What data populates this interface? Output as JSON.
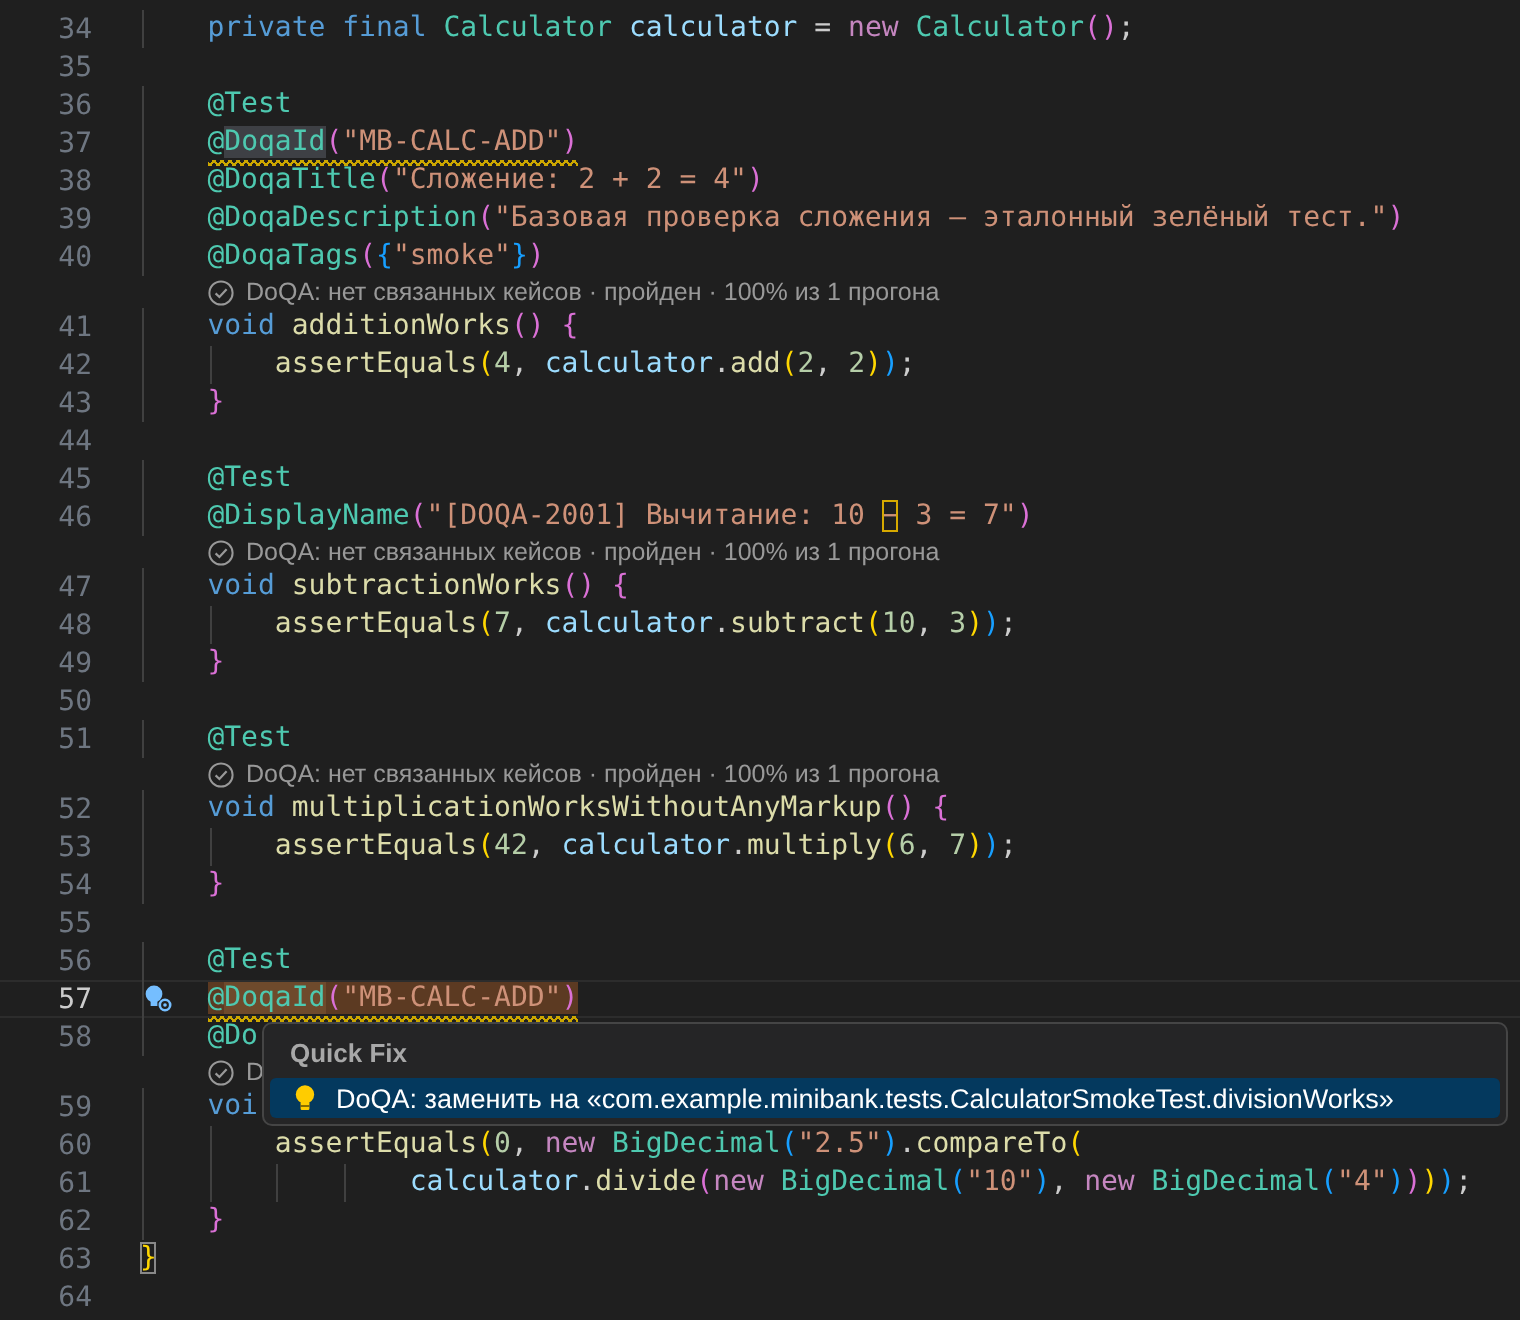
{
  "editor": {
    "lines": [
      {
        "kind": "code",
        "number": "34",
        "current": false,
        "warning": false,
        "tokens": [
          {
            "text": "    private final ",
            "kind": "kw"
          },
          {
            "text": "Calculator",
            "kind": "type"
          },
          {
            "text": " calculator",
            "kind": "var"
          },
          {
            "text": " = ",
            "kind": "plain"
          },
          {
            "text": "new",
            "kind": "ctrl"
          },
          {
            "text": " Calculator",
            "kind": "type"
          },
          {
            "text": "()",
            "kind": "b2"
          },
          {
            "text": ";",
            "kind": "plain"
          }
        ]
      },
      {
        "kind": "code",
        "number": "35",
        "current": false
      },
      {
        "kind": "code",
        "number": "36",
        "current": false,
        "warning": false,
        "tokens": [
          {
            "text": "    @Test",
            "kind": "ann"
          }
        ]
      },
      {
        "kind": "code",
        "number": "37",
        "current": false,
        "warning": true,
        "tokens": [
          {
            "text": "    @",
            "kind": "ann"
          },
          {
            "text": "DoqaId",
            "kind": "ann",
            "symbol_highlight": true
          },
          {
            "text": "(",
            "kind": "b2"
          },
          {
            "text": "\"MB-CALC-ADD\"",
            "kind": "str"
          },
          {
            "text": ")",
            "kind": "b2"
          }
        ]
      },
      {
        "kind": "code",
        "number": "38",
        "current": false,
        "warning": false,
        "tokens": [
          {
            "text": "    @DoqaTitle",
            "kind": "ann"
          },
          {
            "text": "(",
            "kind": "b2"
          },
          {
            "text": "\"Сложение: 2 + 2 = 4\"",
            "kind": "str"
          },
          {
            "text": ")",
            "kind": "b2"
          }
        ]
      },
      {
        "kind": "code",
        "number": "39",
        "current": false,
        "warning": false,
        "tokens": [
          {
            "text": "    @DoqaDescription",
            "kind": "ann"
          },
          {
            "text": "(",
            "kind": "b2"
          },
          {
            "text": "\"Базовая проверка сложения — эталонный зелёный тест.\"",
            "kind": "str"
          },
          {
            "text": ")",
            "kind": "b2"
          }
        ]
      },
      {
        "kind": "code",
        "number": "40",
        "current": false,
        "warning": false,
        "tokens": [
          {
            "text": "    @DoqaTags",
            "kind": "ann"
          },
          {
            "text": "(",
            "kind": "b2"
          },
          {
            "text": "{",
            "kind": "b3"
          },
          {
            "text": "\"smoke\"",
            "kind": "str"
          },
          {
            "text": "}",
            "kind": "b3"
          },
          {
            "text": ")",
            "kind": "b2"
          }
        ]
      },
      {
        "kind": "lens",
        "text": "DoQA: нет связанных кейсов · пройден · 100% из 1 прогона"
      },
      {
        "kind": "code",
        "number": "41",
        "current": false,
        "warning": false,
        "tokens": [
          {
            "text": "    void ",
            "kind": "kw"
          },
          {
            "text": "additionWorks",
            "kind": "fn"
          },
          {
            "text": "() {",
            "kind": "b2"
          }
        ]
      },
      {
        "kind": "code",
        "number": "42",
        "current": false,
        "warning": false,
        "tokens": [
          {
            "text": "        assertEquals",
            "kind": "fn"
          },
          {
            "text": "(",
            "kind": "b1"
          },
          {
            "text": "4",
            "kind": "num"
          },
          {
            "text": ", ",
            "kind": "plain"
          },
          {
            "text": "calculator",
            "kind": "var"
          },
          {
            "text": ".",
            "kind": "plain"
          },
          {
            "text": "add",
            "kind": "fn"
          },
          {
            "text": "(",
            "kind": "b1"
          },
          {
            "text": "2",
            "kind": "num"
          },
          {
            "text": ", ",
            "kind": "plain"
          },
          {
            "text": "2",
            "kind": "num"
          },
          {
            "text": ")",
            "kind": "b1"
          },
          {
            "text": ")",
            "kind": "b3"
          },
          {
            "text": ";",
            "kind": "plain"
          }
        ]
      },
      {
        "kind": "code",
        "number": "43",
        "current": false,
        "warning": false,
        "tokens": [
          {
            "text": "    }",
            "kind": "b2"
          }
        ]
      },
      {
        "kind": "code",
        "number": "44",
        "current": false
      },
      {
        "kind": "code",
        "number": "45",
        "current": false,
        "warning": false,
        "tokens": [
          {
            "text": "    @Test",
            "kind": "ann"
          }
        ]
      },
      {
        "kind": "code",
        "number": "46",
        "current": false,
        "warning": false,
        "tokens": [
          {
            "text": "    @DisplayName",
            "kind": "ann"
          },
          {
            "text": "(",
            "kind": "b2"
          },
          {
            "text": "\"[DOQA-2001] Вычитание: 10 ",
            "kind": "str"
          },
          {
            "text": "−",
            "kind": "str",
            "ambiguous": true
          },
          {
            "text": " 3 = 7\"",
            "kind": "str"
          },
          {
            "text": ")",
            "kind": "b2"
          }
        ]
      },
      {
        "kind": "lens",
        "text": "DoQA: нет связанных кейсов · пройден · 100% из 1 прогона"
      },
      {
        "kind": "code",
        "number": "47",
        "current": false,
        "warning": false,
        "tokens": [
          {
            "text": "    void ",
            "kind": "kw"
          },
          {
            "text": "subtractionWorks",
            "kind": "fn"
          },
          {
            "text": "() {",
            "kind": "b2"
          }
        ]
      },
      {
        "kind": "code",
        "number": "48",
        "current": false,
        "warning": false,
        "tokens": [
          {
            "text": "        assertEquals",
            "kind": "fn"
          },
          {
            "text": "(",
            "kind": "b1"
          },
          {
            "text": "7",
            "kind": "num"
          },
          {
            "text": ", ",
            "kind": "plain"
          },
          {
            "text": "calculator",
            "kind": "var"
          },
          {
            "text": ".",
            "kind": "plain"
          },
          {
            "text": "subtract",
            "kind": "fn"
          },
          {
            "text": "(",
            "kind": "b1"
          },
          {
            "text": "10",
            "kind": "num"
          },
          {
            "text": ", ",
            "kind": "plain"
          },
          {
            "text": "3",
            "kind": "num"
          },
          {
            "text": ")",
            "kind": "b1"
          },
          {
            "text": ")",
            "kind": "b3"
          },
          {
            "text": ";",
            "kind": "plain"
          }
        ]
      },
      {
        "kind": "code",
        "number": "49",
        "current": false,
        "warning": false,
        "tokens": [
          {
            "text": "    }",
            "kind": "b2"
          }
        ]
      },
      {
        "kind": "code",
        "number": "50",
        "current": false
      },
      {
        "kind": "code",
        "number": "51",
        "current": false,
        "warning": false,
        "tokens": [
          {
            "text": "    @Test",
            "kind": "ann"
          }
        ]
      },
      {
        "kind": "lens",
        "text": "DoQA: нет связанных кейсов · пройден · 100% из 1 прогона"
      },
      {
        "kind": "code",
        "number": "52",
        "current": false,
        "warning": false,
        "tokens": [
          {
            "text": "    void ",
            "kind": "kw"
          },
          {
            "text": "multiplicationWorksWithoutAnyMarkup",
            "kind": "fn"
          },
          {
            "text": "() {",
            "kind": "b2"
          }
        ]
      },
      {
        "kind": "code",
        "number": "53",
        "current": false,
        "warning": false,
        "tokens": [
          {
            "text": "        assertEquals",
            "kind": "fn"
          },
          {
            "text": "(",
            "kind": "b1"
          },
          {
            "text": "42",
            "kind": "num"
          },
          {
            "text": ", ",
            "kind": "plain"
          },
          {
            "text": "calculator",
            "kind": "var"
          },
          {
            "text": ".",
            "kind": "plain"
          },
          {
            "text": "multiply",
            "kind": "fn"
          },
          {
            "text": "(",
            "kind": "b1"
          },
          {
            "text": "6",
            "kind": "num"
          },
          {
            "text": ", ",
            "kind": "plain"
          },
          {
            "text": "7",
            "kind": "num"
          },
          {
            "text": ")",
            "kind": "b1"
          },
          {
            "text": ")",
            "kind": "b3"
          },
          {
            "text": ";",
            "kind": "plain"
          }
        ]
      },
      {
        "kind": "code",
        "number": "54",
        "current": false,
        "warning": false,
        "tokens": [
          {
            "text": "    }",
            "kind": "b2"
          }
        ]
      },
      {
        "kind": "code",
        "number": "55",
        "current": false
      },
      {
        "kind": "code",
        "number": "56",
        "current": false,
        "warning": false,
        "tokens": [
          {
            "text": "    @Test",
            "kind": "ann"
          }
        ]
      },
      {
        "kind": "code",
        "number": "57",
        "current": true,
        "warning": true,
        "tokens": [
          {
            "text": "    @",
            "kind": "ann",
            "quick_fix": true
          },
          {
            "text": "DoqaId",
            "kind": "ann",
            "quick_fix": true,
            "symbol_highlight": true
          },
          {
            "text": "(",
            "kind": "b2",
            "quick_fix": true
          },
          {
            "text": "\"MB-CALC-ADD\"",
            "kind": "str",
            "quick_fix": true
          },
          {
            "text": ")",
            "kind": "b2",
            "quick_fix": true
          }
        ]
      },
      {
        "kind": "code",
        "number": "58",
        "current": false,
        "warning": false,
        "tokens": [
          {
            "text": "    @Do",
            "kind": "ann"
          }
        ]
      },
      {
        "kind": "lens",
        "text": "D"
      },
      {
        "kind": "code",
        "number": "59",
        "current": false,
        "warning": false,
        "tokens": [
          {
            "text": "    voi",
            "kind": "kw"
          }
        ]
      },
      {
        "kind": "code",
        "number": "60",
        "current": false,
        "warning": false,
        "tokens": [
          {
            "text": "        assertEquals",
            "kind": "fn"
          },
          {
            "text": "(",
            "kind": "b1"
          },
          {
            "text": "0",
            "kind": "num"
          },
          {
            "text": ", ",
            "kind": "plain"
          },
          {
            "text": "new",
            "kind": "ctrl"
          },
          {
            "text": " BigDecimal",
            "kind": "type"
          },
          {
            "text": "(",
            "kind": "b3"
          },
          {
            "text": "\"2.5\"",
            "kind": "str"
          },
          {
            "text": ")",
            "kind": "b3"
          },
          {
            "text": ".",
            "kind": "plain"
          },
          {
            "text": "compareTo",
            "kind": "fn"
          },
          {
            "text": "(",
            "kind": "b1"
          }
        ]
      },
      {
        "kind": "code",
        "number": "61",
        "current": false,
        "warning": false,
        "tokens": [
          {
            "text": "                calculator",
            "kind": "var"
          },
          {
            "text": ".",
            "kind": "plain"
          },
          {
            "text": "divide",
            "kind": "fn"
          },
          {
            "text": "(",
            "kind": "b2"
          },
          {
            "text": "new",
            "kind": "ctrl"
          },
          {
            "text": " BigDecimal",
            "kind": "type"
          },
          {
            "text": "(",
            "kind": "b3"
          },
          {
            "text": "\"10\"",
            "kind": "str"
          },
          {
            "text": ")",
            "kind": "b3"
          },
          {
            "text": ", ",
            "kind": "plain"
          },
          {
            "text": "new",
            "kind": "ctrl"
          },
          {
            "text": " BigDecimal",
            "kind": "type"
          },
          {
            "text": "(",
            "kind": "b3"
          },
          {
            "text": "\"4\"",
            "kind": "str"
          },
          {
            "text": ")",
            "kind": "b3"
          },
          {
            "text": ")",
            "kind": "b2"
          },
          {
            "text": ")",
            "kind": "b1"
          },
          {
            "text": ")",
            "kind": "b3"
          },
          {
            "text": ";",
            "kind": "plain"
          }
        ]
      },
      {
        "kind": "code",
        "number": "62",
        "current": false,
        "warning": false,
        "tokens": [
          {
            "text": "    }",
            "kind": "b2"
          }
        ]
      },
      {
        "kind": "code",
        "number": "63",
        "current": false,
        "warning": false,
        "tokens": [
          {
            "text": "}",
            "kind": "b1",
            "bracket_match": true
          }
        ]
      },
      {
        "kind": "code",
        "number": "64",
        "current": false
      }
    ]
  },
  "quick_fix": {
    "title": "Quick Fix",
    "items": [
      {
        "text": "DoQA: заменить на «com.example.minibank.tests.CalculatorSmokeTest.divisionWorks»",
        "selected": true
      }
    ]
  }
}
